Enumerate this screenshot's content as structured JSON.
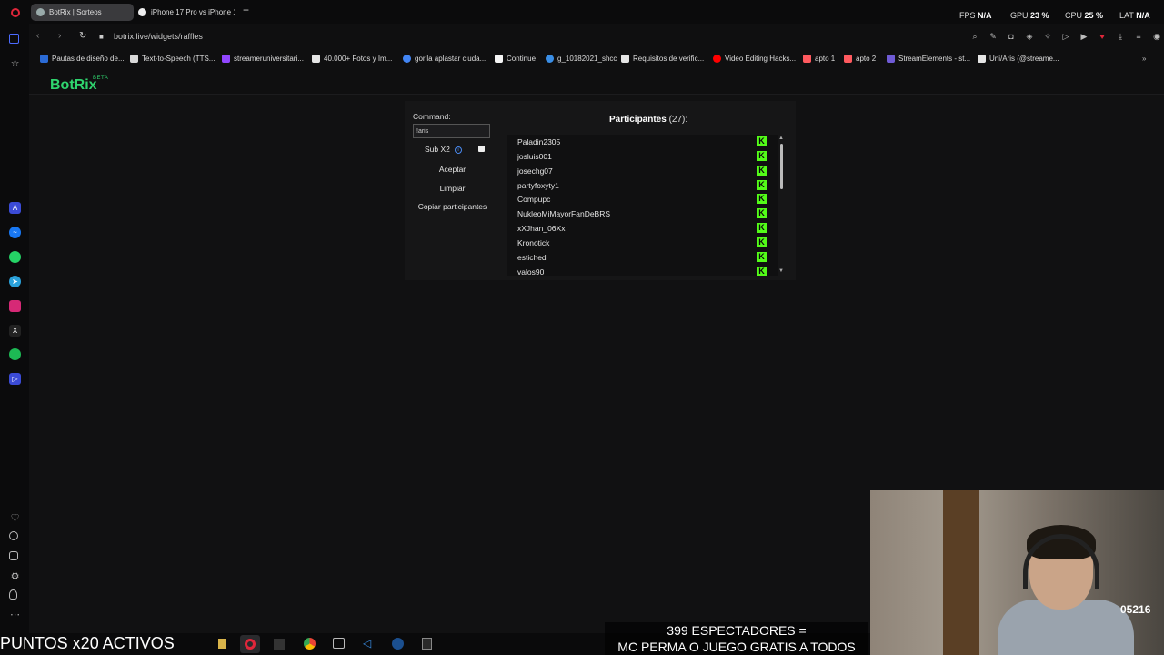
{
  "tabs": [
    {
      "label": "BotRix | Sorteos",
      "active": true
    },
    {
      "label": "iPhone 17 Pro vs iPhone 1",
      "active": false
    }
  ],
  "perf": {
    "fps_label": "FPS",
    "fps_value": "N/A",
    "gpu_label": "GPU",
    "gpu_value": "23 %",
    "cpu_label": "CPU",
    "cpu_value": "25 %",
    "lat_label": "LAT",
    "lat_value": "N/A"
  },
  "address": {
    "url": "botrix.live/widgets/raffles"
  },
  "bookmarks": [
    {
      "label": "Pautas de diseño de...",
      "color": "#2b6bd6"
    },
    {
      "label": "Text-to-Speech (TTS...",
      "color": "#d9d9d9"
    },
    {
      "label": "streameruniversitari...",
      "color": "#9146ff"
    },
    {
      "label": "40.000+ Fotos y Im...",
      "color": "#e5e5e5"
    },
    {
      "label": "gorila aplastar ciuda...",
      "color": "#4285f4"
    },
    {
      "label": "Continue",
      "color": "#f5f5f5"
    },
    {
      "label": "g_10182021_shcc",
      "color": "#3a8ee6"
    },
    {
      "label": "Requisitos de verific...",
      "color": "#e5e5e5"
    },
    {
      "label": "Video Editing Hacks...",
      "color": "#ff0000"
    },
    {
      "label": "apto 1",
      "color": "#ff5a5f"
    },
    {
      "label": "apto 2",
      "color": "#ff5a5f"
    },
    {
      "label": "StreamElements - st...",
      "color": "#6f5bd6"
    },
    {
      "label": "Uni/Aris (@streame...",
      "color": "#e5e5e5"
    }
  ],
  "header": {
    "logo": "BotRix",
    "beta": "BETA"
  },
  "raffle": {
    "command_label": "Command:",
    "command_value": "!aris",
    "sub_label": "Sub X2",
    "info_icon": "i",
    "accept": "Aceptar",
    "clear": "Limpiar",
    "copy": "Copiar participantes",
    "participants_title": "Participantes",
    "participants_count": "(27):",
    "participants": [
      "Paladin2305",
      "josluis001",
      "josechg07",
      "partyfoxyty1",
      "Compupc",
      "NukleoMiMayorFanDeBRS",
      "xXJhan_06Xx",
      "Kronotick",
      "estichedi",
      "valos90"
    ],
    "platform_badge": "K"
  },
  "overlay": {
    "points": "PUNTOS x20 ACTIVOS",
    "viewers_line1": "399 ESPECTADORES =",
    "viewers_line2": "MC PERMA O JUEGO GRATIS A TODOS",
    "cam_badge": "05216"
  },
  "sidebar_icons": [
    "opera-icon",
    "home-icon",
    "star-icon",
    "aria-icon",
    "messenger-icon",
    "whatsapp-icon",
    "telegram-icon",
    "instagram-icon",
    "x-icon",
    "spotify-icon",
    "player-icon",
    "heart-icon",
    "history-icon",
    "cube-icon",
    "settings-icon",
    "bulb-icon",
    "more-icon"
  ]
}
